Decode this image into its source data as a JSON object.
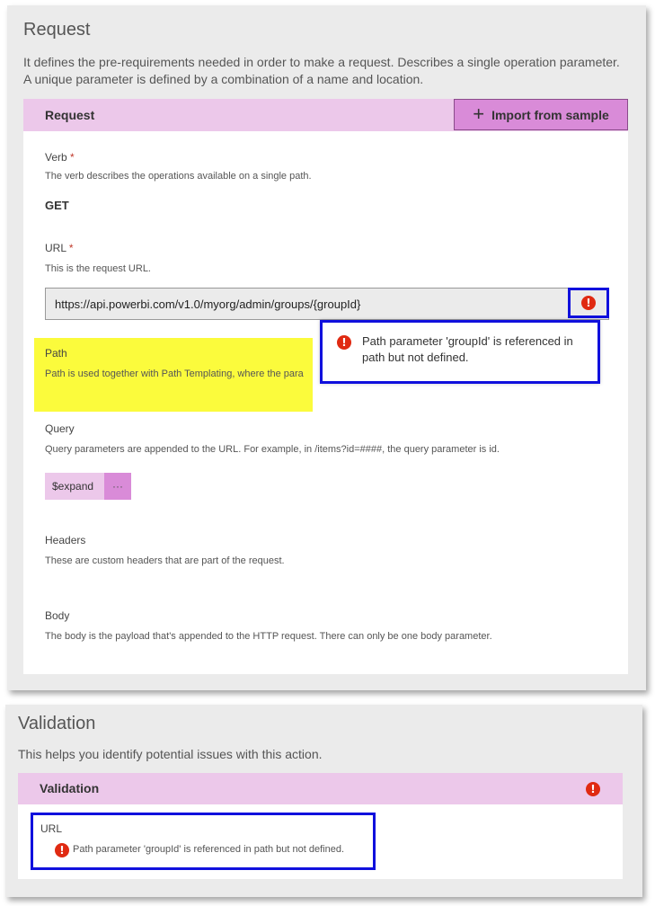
{
  "request": {
    "title": "Request",
    "description_line1": "It defines the pre-requirements needed in order to make a request. Describes a single operation parameter.",
    "description_line2": "A unique parameter is defined by a combination of a name and location.",
    "card_header": "Request",
    "import_button": "Import from sample",
    "verb": {
      "label": "Verb",
      "required_mark": "*",
      "help": "The verb describes the operations available on a single path.",
      "value": "GET"
    },
    "url": {
      "label": "URL",
      "required_mark": "*",
      "help": "This is the request URL.",
      "value": "https://api.powerbi.com/v1.0/myorg/admin/groups/{groupId}"
    },
    "path": {
      "label": "Path",
      "help": "Path is used together with Path Templating, where the para"
    },
    "tooltip": {
      "message": "Path parameter 'groupId' is referenced in path but not defined."
    },
    "query": {
      "label": "Query",
      "help": "Query parameters are appended to the URL. For example, in /items?id=####, the query parameter is id.",
      "chip_label": "$expand",
      "chip_more": "···"
    },
    "headers": {
      "label": "Headers",
      "help": "These are custom headers that are part of the request."
    },
    "body": {
      "label": "Body",
      "help": "The body is the payload that's appended to the HTTP request. There can only be one body parameter."
    }
  },
  "validation": {
    "title": "Validation",
    "description": "This helps you identify potential issues with this action.",
    "card_header": "Validation",
    "item_label": "URL",
    "item_message": "Path parameter 'groupId' is referenced in path but not defined."
  },
  "icons": {
    "error_glyph": "!",
    "error_color": "#e02a12",
    "accent_color": "#d98bd8",
    "header_color": "#ecc8ea",
    "highlight_color": "#fbfb3c",
    "annotation_color": "#1010dd"
  }
}
